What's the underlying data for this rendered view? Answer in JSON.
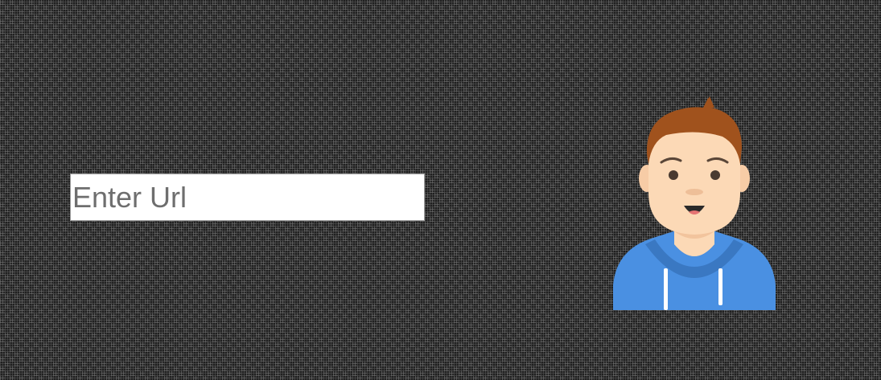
{
  "url_input": {
    "placeholder": "Enter Url",
    "value": ""
  },
  "avatar": {
    "icon": "user-avatar-icon",
    "colors": {
      "hair": "#a0521d",
      "skin": "#fcd9b6",
      "hoodie": "#4a90e2",
      "hoodie_shadow": "#3a78c2",
      "strings": "#ffffff"
    }
  }
}
